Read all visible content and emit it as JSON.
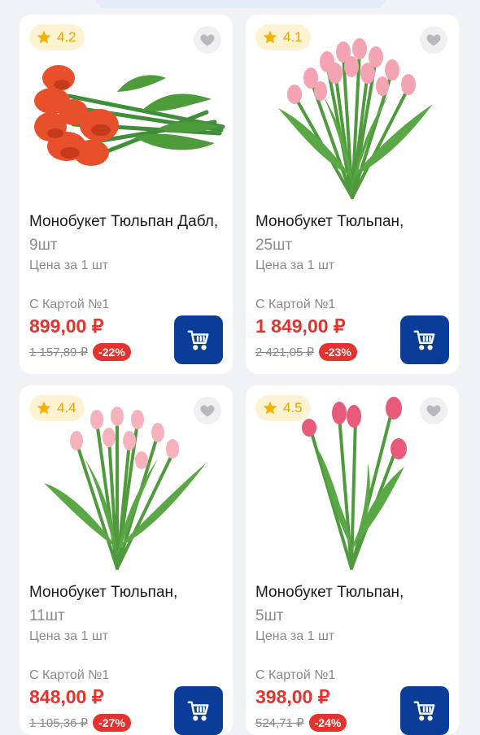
{
  "products": [
    {
      "rating": "4.2",
      "title_main": "Монобукет Тюльпан Дабл,",
      "title_qty": "9шт",
      "unit_label": "Цена за 1 шт",
      "card_label": "С Картой №1",
      "price": "899,00 ₽",
      "old_price": "1 157,89 ₽",
      "discount": "-22%",
      "flower_color": "#e8502c",
      "image_icon": "red-tulip-bouquet-horizontal"
    },
    {
      "rating": "4.1",
      "title_main": "Монобукет Тюльпан,",
      "title_qty": "25шт",
      "unit_label": "Цена за 1 шт",
      "card_label": "С Картой №1",
      "price": "1 849,00 ₽",
      "old_price": "2 421,05 ₽",
      "discount": "-23%",
      "flower_color": "#f4a3b3",
      "image_icon": "pink-tulip-bouquet"
    },
    {
      "rating": "4.4",
      "title_main": "Монобукет Тюльпан,",
      "title_qty": "11шт",
      "unit_label": "Цена за 1 шт",
      "card_label": "С Картой №1",
      "price": "848,00 ₽",
      "old_price": "1 105,36 ₽",
      "discount": "-27%",
      "flower_color": "#f5b2bd",
      "image_icon": "light-pink-tulip-bouquet"
    },
    {
      "rating": "4.5",
      "title_main": "Монобукет Тюльпан,",
      "title_qty": "5шт",
      "unit_label": "Цена за 1 шт",
      "card_label": "С Картой №1",
      "price": "398,00 ₽",
      "old_price": "524,71 ₽",
      "discount": "-24%",
      "flower_color": "#e85a7a",
      "image_icon": "pink-tulip-bouquet-small"
    }
  ],
  "colors": {
    "price_red": "#e4332d",
    "cart_blue": "#0a3d99",
    "rating_bg": "#fdf3d2",
    "rating_star": "#f2b300"
  },
  "icons": {
    "rating": "star-icon",
    "favorite": "heart-icon",
    "cart": "cart-icon"
  }
}
